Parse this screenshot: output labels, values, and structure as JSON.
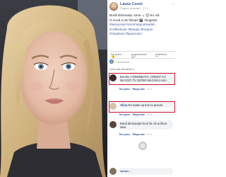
{
  "post": {
    "author": "Laura Cosoi",
    "timestamp": "Pagina asociată · 17 h",
    "caption_lines": [
      "Bună dimineața, lume ☕ 😊 Nu mă",
      "O nouă zi de filmare 🎬 #sugestii",
      "#lauracosoi #morningmotivation",
      "#coffeelover #beauty #bonjour",
      "#ziradeazi #lauracosoi"
    ]
  },
  "actions": {
    "like": "Îmi place",
    "comment": "Comentează",
    "share": "Distribuie"
  },
  "reactions": {
    "count": "1 distribuire"
  },
  "comments_sort": "Cele mai relevante ▾",
  "comments": [
    {
      "author": "Ioa",
      "text": "NU A DIMINEAȚA, CREZIT CĂ NU EȘTI TU SCRIE MACHIAJ ASA",
      "links": [
        "Îmi place",
        "Răspunde",
        "17 h"
      ]
    },
    {
      "author": "Alina",
      "text": "No make up but no picture",
      "links": [
        "Îmi place",
        "Răspunde",
        "17 h"
      ]
    },
    {
      "author": "",
      "text": "Bună dimineața! Nu-ți fie că ai făcut asta",
      "links": [
        "Îmi place",
        "Răspunde",
        "17 h"
      ]
    }
  ],
  "reply_preview": {
    "author": "Adrian",
    "text": "..."
  },
  "colors": {
    "link": "#385898",
    "highlight_box": "#c8102e",
    "bubble": "#f2f3f5",
    "like": "#1877f2"
  },
  "icons": {
    "like": "thumbs-up-icon",
    "comment": "speech-bubble-icon",
    "share": "share-arrow-icon",
    "more": "more-dots-icon"
  }
}
